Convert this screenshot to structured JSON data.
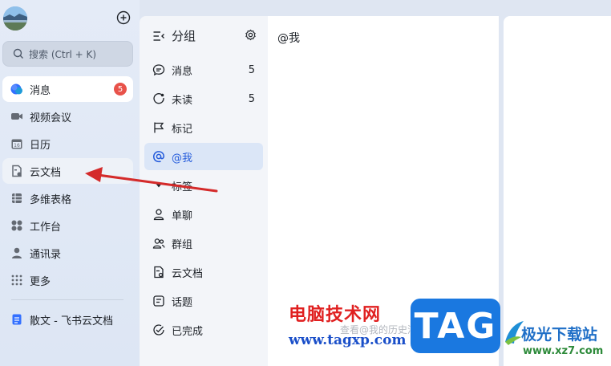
{
  "sidebar": {
    "search_placeholder": "搜索 (Ctrl + K)",
    "items": [
      {
        "label": "消息",
        "badge": "5",
        "icon": "chat-bubble-icon"
      },
      {
        "label": "视频会议",
        "icon": "video-camera-icon"
      },
      {
        "label": "日历",
        "icon": "calendar-icon"
      },
      {
        "label": "云文档",
        "icon": "cloud-doc-icon"
      },
      {
        "label": "多维表格",
        "icon": "table-icon"
      },
      {
        "label": "工作台",
        "icon": "apps-grid-icon"
      },
      {
        "label": "通讯录",
        "icon": "contacts-icon"
      },
      {
        "label": "更多",
        "icon": "dots-grid-icon"
      }
    ],
    "pinned_doc": "散文 - 飞书云文档",
    "calendar_day": "16"
  },
  "groups": {
    "title": "分组",
    "items": [
      {
        "label": "消息",
        "count": "5"
      },
      {
        "label": "未读",
        "count": "5"
      },
      {
        "label": "标记"
      },
      {
        "label": "@我"
      },
      {
        "label": "标签"
      },
      {
        "label": "单聊"
      },
      {
        "label": "群组"
      },
      {
        "label": "云文档"
      },
      {
        "label": "话题"
      },
      {
        "label": "已完成"
      }
    ]
  },
  "message_panel": {
    "title": "@我",
    "empty_hint": "查看@我的历史消息"
  },
  "watermark": {
    "cn_text": "电脑技术网",
    "url": "www.tagxp.com",
    "tag": "TAG",
    "site_name": "极光下载站",
    "site_url": "www.xz7.com"
  },
  "colors": {
    "accent": "#245bdb",
    "badge": "#e8524a",
    "arrow": "#d42a2a"
  }
}
